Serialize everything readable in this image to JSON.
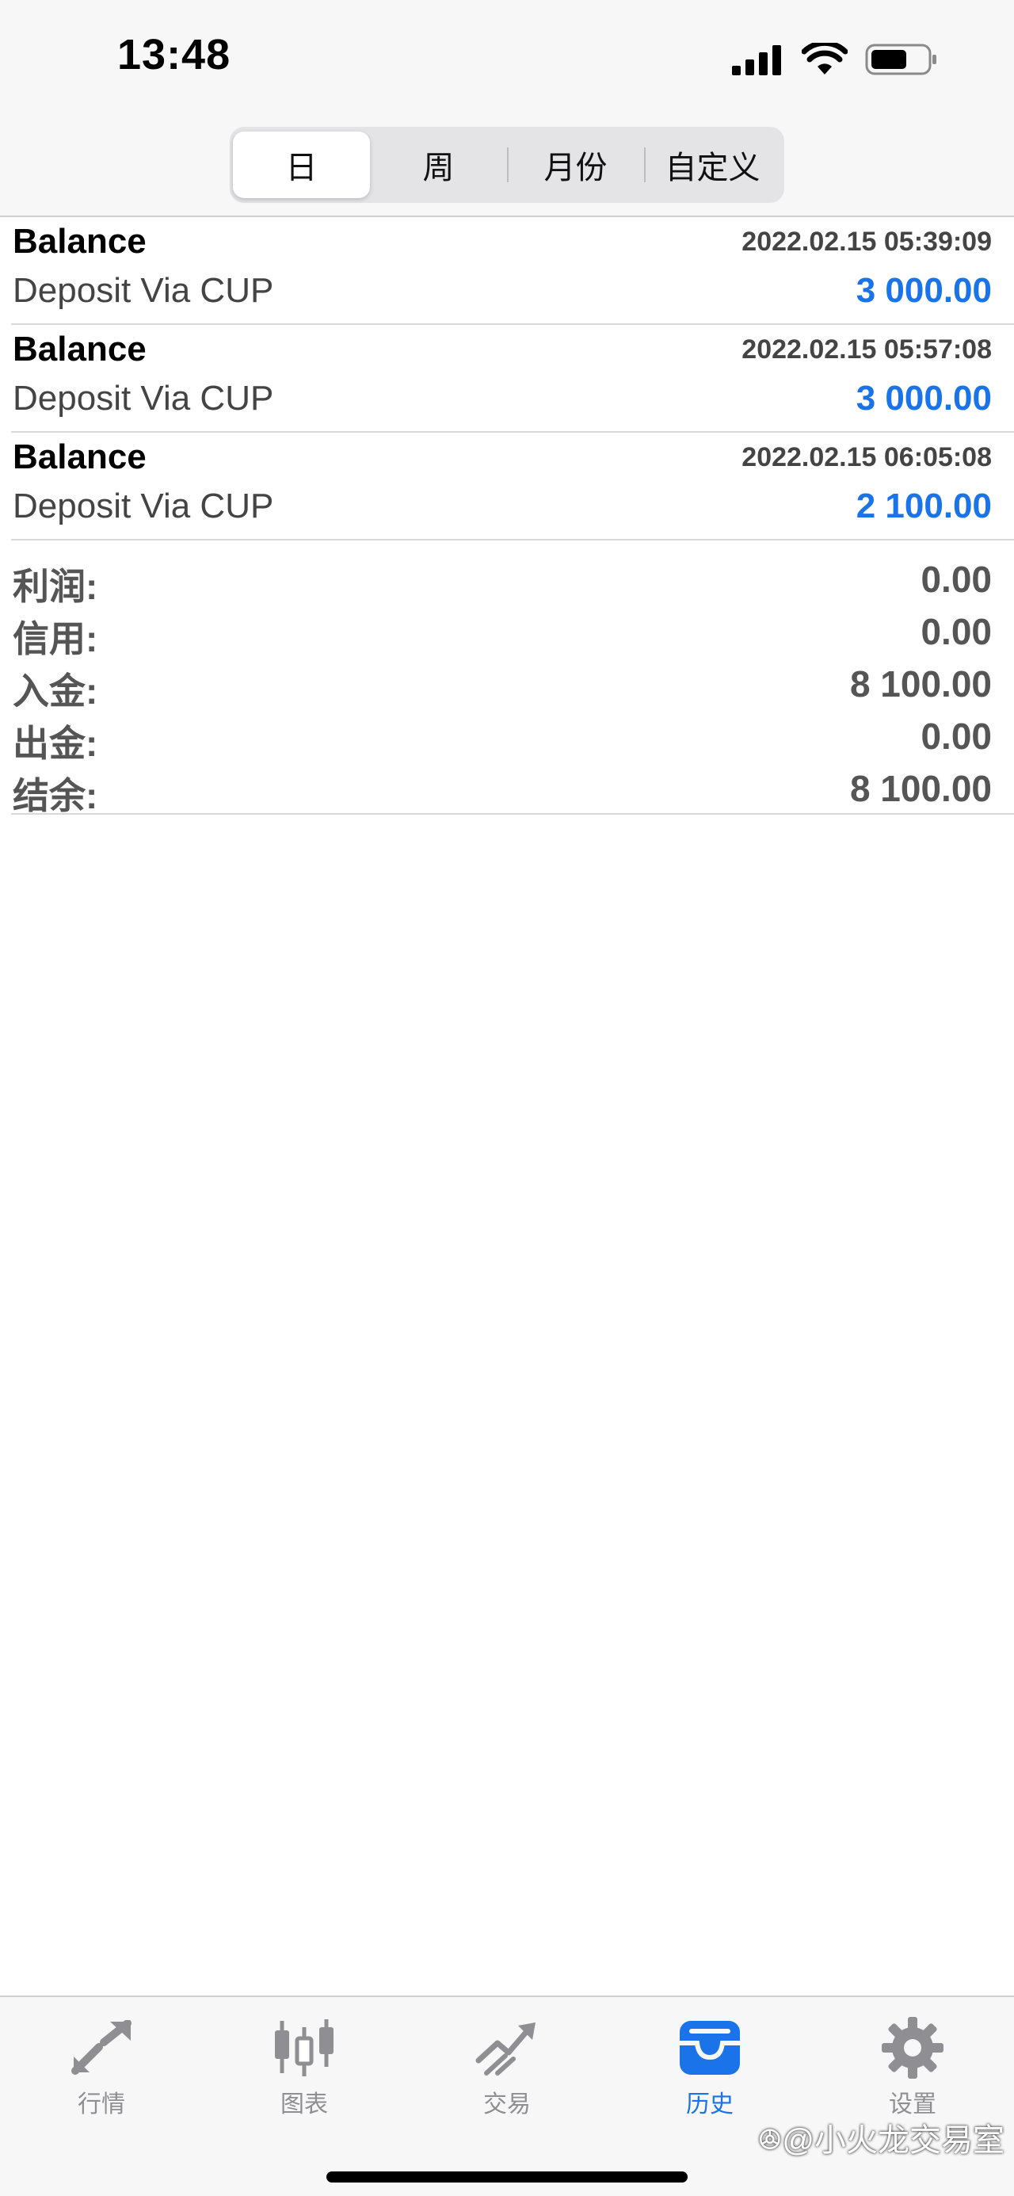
{
  "status_bar": {
    "time": "13:48"
  },
  "segments": [
    {
      "label": "日",
      "active": true
    },
    {
      "label": "周",
      "active": false
    },
    {
      "label": "月份",
      "active": false
    },
    {
      "label": "自定义",
      "active": false
    }
  ],
  "transactions": [
    {
      "type": "Balance",
      "time": "2022.02.15 05:39:09",
      "comment": "Deposit Via CUP",
      "amount": "3 000.00"
    },
    {
      "type": "Balance",
      "time": "2022.02.15 05:57:08",
      "comment": "Deposit Via CUP",
      "amount": "3 000.00"
    },
    {
      "type": "Balance",
      "time": "2022.02.15 06:05:08",
      "comment": "Deposit Via CUP",
      "amount": "2 100.00"
    }
  ],
  "summary": [
    {
      "label": "利润:",
      "value": "0.00"
    },
    {
      "label": "信用:",
      "value": "0.00"
    },
    {
      "label": "入金:",
      "value": "8 100.00"
    },
    {
      "label": "出金:",
      "value": "0.00"
    },
    {
      "label": "结余:",
      "value": "8 100.00"
    }
  ],
  "tabs": [
    {
      "label": "行情",
      "icon": "quotes-arrows-icon"
    },
    {
      "label": "图表",
      "icon": "candlestick-chart-icon"
    },
    {
      "label": "交易",
      "icon": "trade-trend-icon"
    },
    {
      "label": "历史",
      "icon": "history-inbox-icon"
    },
    {
      "label": "设置",
      "icon": "gear-icon"
    }
  ],
  "active_tab": "历史",
  "watermark": "ꔮ@小火龙交易室",
  "colors": {
    "accent": "#1a73e8",
    "inactive": "#8e8e93"
  }
}
